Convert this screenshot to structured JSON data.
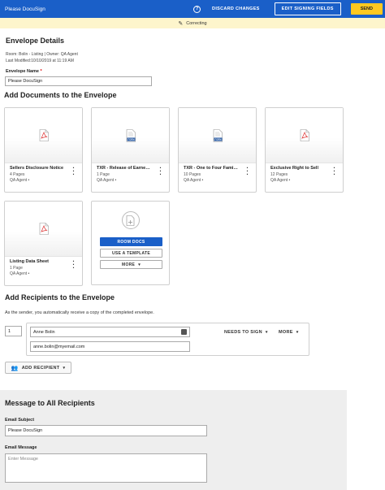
{
  "topbar": {
    "title": "Please DocuSign",
    "help_icon": "question-circle-icon",
    "discard_label": "DISCARD CHANGES",
    "edit_label": "EDIT SIGNING FIELDS",
    "send_label": "SEND",
    "brand_color": "#1a5fc8",
    "send_color": "#ffc820"
  },
  "status": {
    "icon": "pencil-icon",
    "text": "Correcting"
  },
  "envelope": {
    "heading": "Envelope Details",
    "meta_line1": "Room: Bolin - Listing | Owner: QA Agent",
    "meta_line2": "Last Modified:10/10/2019 at 11:19 AM",
    "name_label": "Envelope Name",
    "name_required": "*",
    "name_value": "Please DocuSign"
  },
  "documents": {
    "heading": "Add Documents to the Envelope",
    "items": [
      {
        "name": "Sellers Disclosure Notice",
        "pages": "4 Pages",
        "owner": "QA Agent •",
        "icon": "pdf-icon"
      },
      {
        "name": "TXR - Release of Earne…",
        "pages": "1 Page",
        "owner": "QA Agent •",
        "icon": "form-icon",
        "icon_text": "FORM"
      },
      {
        "name": "TXR - One to Four Fami…",
        "pages": "10 Pages",
        "owner": "QA Agent •",
        "icon": "form-icon",
        "icon_text": "FORM"
      },
      {
        "name": "Exclusive Right to Sell",
        "pages": "12 Pages",
        "owner": "QA Agent •",
        "icon": "pdf-icon"
      },
      {
        "name": "Listing Data Sheet",
        "pages": "1 Page",
        "owner": "QA Agent •",
        "icon": "pdf-icon"
      }
    ],
    "add_card": {
      "icon": "add-document-icon",
      "room_docs_label": "ROOM DOCS",
      "template_label": "USE A TEMPLATE",
      "more_label": "MORE"
    }
  },
  "recipients": {
    "heading": "Add Recipients to the Envelope",
    "note": "As the sender, you automatically receive a copy of the completed envelope.",
    "list": [
      {
        "order": "1",
        "name": "Anne Bolin",
        "email": "anne.bolin@myemail.com",
        "role": "NEEDS TO SIGN",
        "more": "MORE"
      }
    ],
    "add_label": "ADD RECIPIENT"
  },
  "message": {
    "heading": "Message to All Recipients",
    "subject_label": "Email Subject",
    "subject_value": "Please DocuSign",
    "message_label": "Email Message",
    "message_placeholder": "Enter Message"
  }
}
